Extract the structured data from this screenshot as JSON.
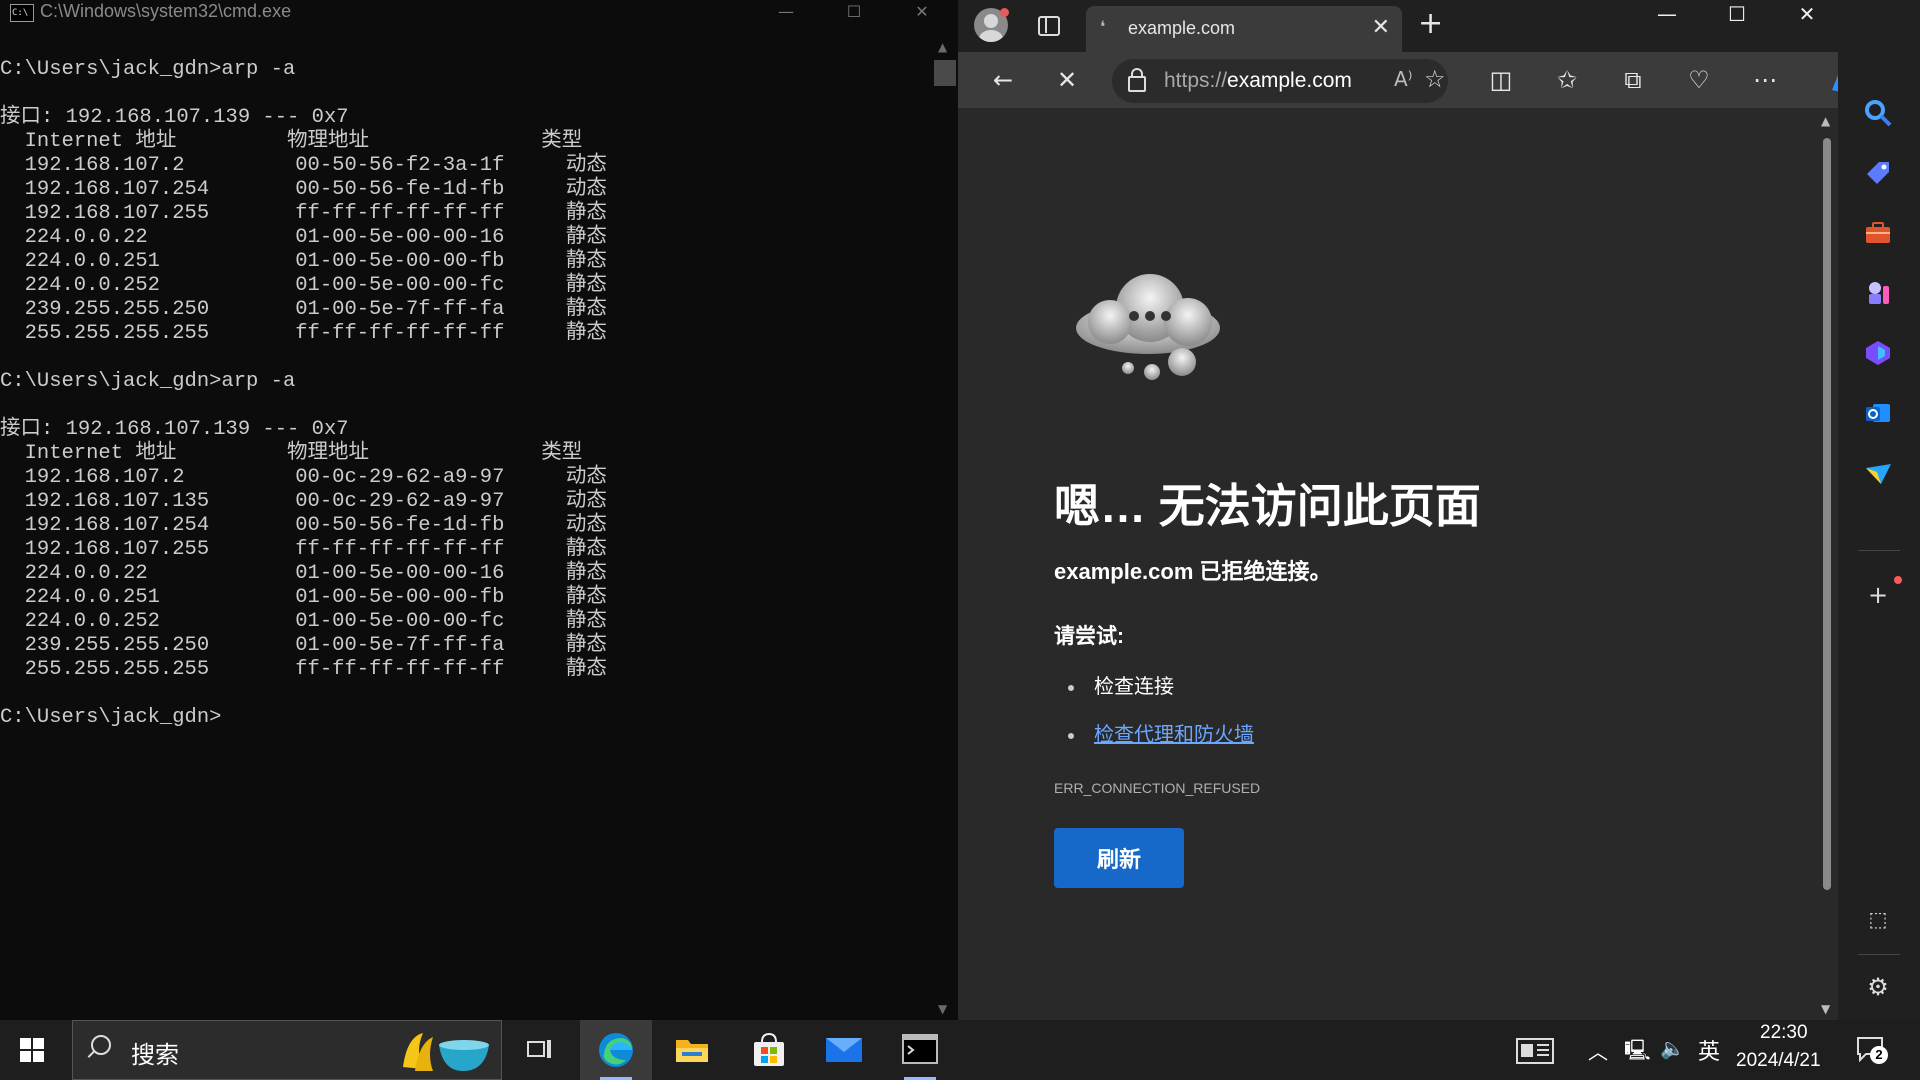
{
  "cmd": {
    "title": "C:\\Windows\\system32\\cmd.exe",
    "icon_text": "C:\\",
    "lines": [
      "C:\\Users\\jack_gdn>arp -a",
      "",
      "接口: 192.168.107.139 --- 0x7",
      "  Internet 地址         物理地址              类型",
      "  192.168.107.2         00-50-56-f2-3a-1f     动态",
      "  192.168.107.254       00-50-56-fe-1d-fb     动态",
      "  192.168.107.255       ff-ff-ff-ff-ff-ff     静态",
      "  224.0.0.22            01-00-5e-00-00-16     静态",
      "  224.0.0.251           01-00-5e-00-00-fb     静态",
      "  224.0.0.252           01-00-5e-00-00-fc     静态",
      "  239.255.255.250       01-00-5e-7f-ff-fa     静态",
      "  255.255.255.255       ff-ff-ff-ff-ff-ff     静态",
      "",
      "C:\\Users\\jack_gdn>arp -a",
      "",
      "接口: 192.168.107.139 --- 0x7",
      "  Internet 地址         物理地址              类型",
      "  192.168.107.2         00-0c-29-62-a9-97     动态",
      "  192.168.107.135       00-0c-29-62-a9-97     动态",
      "  192.168.107.254       00-50-56-fe-1d-fb     动态",
      "  192.168.107.255       ff-ff-ff-ff-ff-ff     静态",
      "  224.0.0.22            01-00-5e-00-00-16     静态",
      "  224.0.0.251           01-00-5e-00-00-fb     静态",
      "  224.0.0.252           01-00-5e-00-00-fc     静态",
      "  239.255.255.250       01-00-5e-7f-ff-fa     静态",
      "  255.255.255.255       ff-ff-ff-ff-ff-ff     静态",
      "",
      "C:\\Users\\jack_gdn>"
    ],
    "controls": {
      "minimize": "—",
      "maximize": "☐",
      "close": "✕"
    }
  },
  "browser": {
    "tab": {
      "title": "example.com",
      "close": "✕",
      "loading": "❛"
    },
    "new_tab": "+",
    "window_controls": {
      "minimize": "—",
      "maximize": "☐",
      "close": "✕"
    },
    "address": {
      "scheme": "https://",
      "host": "example.com",
      "read_aloud": "A⁾"
    },
    "page": {
      "heading": "嗯… 无法访问此页面",
      "subheading": "example.com 已拒绝连接。",
      "try_label": "请尝试:",
      "suggestions": [
        {
          "text": "检查连接",
          "link": false
        },
        {
          "text": "检查代理和防火墙",
          "link": true
        }
      ],
      "error_code": "ERR_CONNECTION_REFUSED",
      "refresh_button": "刷新"
    },
    "sidebar_icons": [
      "search-icon",
      "shopping-tag-icon",
      "tools-icon",
      "games-icon",
      "office-icon",
      "outlook-icon",
      "send-icon",
      "add-icon",
      "screenshot-icon",
      "settings-icon"
    ]
  },
  "taskbar": {
    "search_text": "搜索",
    "ime": "英",
    "time": "22:30",
    "date": "2024/4/21",
    "notification_count": "2"
  },
  "colors": {
    "cmd_bg": "#0c0c0c",
    "cmd_text": "#cccccc",
    "browser_bg": "#292929",
    "accent": "#1769c9",
    "link": "#6aa7ff"
  }
}
